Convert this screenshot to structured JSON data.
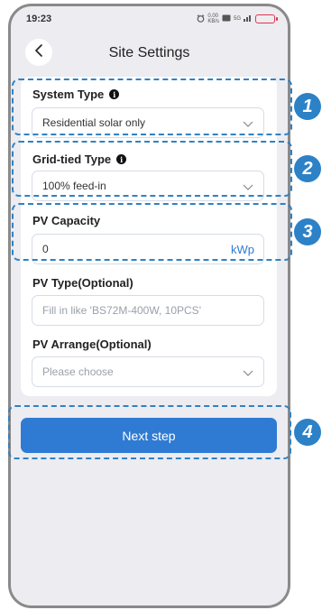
{
  "status_bar": {
    "time": "19:23",
    "speed": "0.00",
    "speed_unit": "KB/s",
    "network": "5G"
  },
  "header": {
    "title": "Site Settings"
  },
  "form": {
    "system_type": {
      "label": "System Type",
      "value": "Residential solar only"
    },
    "grid_tied_type": {
      "label": "Grid-tied Type",
      "value": "100% feed-in"
    },
    "pv_capacity": {
      "label": "PV Capacity",
      "value": "0",
      "unit": "kWp"
    },
    "pv_type": {
      "label": "PV Type(Optional)",
      "placeholder": "Fill in like 'BS72M-400W, 10PCS'"
    },
    "pv_arrange": {
      "label": "PV Arrange(Optional)",
      "placeholder": "Please choose"
    }
  },
  "next_button": {
    "label": "Next step"
  },
  "annotations": [
    "1",
    "2",
    "3",
    "4"
  ],
  "colors": {
    "accent": "#2f7bd3",
    "annotation": "#2e82c4",
    "background": "#ececf1"
  }
}
